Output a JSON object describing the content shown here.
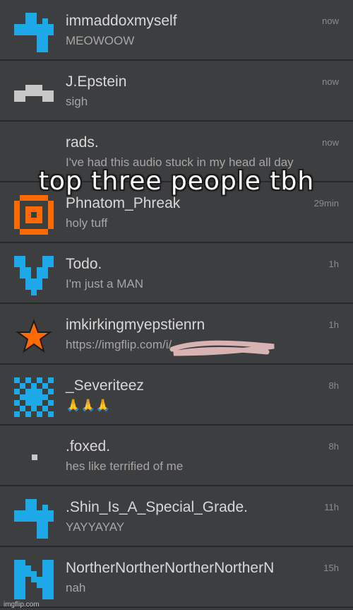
{
  "colors": {
    "blue": "#1da8e8",
    "orange": "#ff6a00",
    "gray": "#c8c8c8",
    "scribble": "#d7b3b3"
  },
  "rows": [
    {
      "name": "immaddoxmyself",
      "message": "MEOWOOW",
      "time": "now",
      "avatar": "blue-hook-icon"
    },
    {
      "name": "J.Epstein",
      "message": "sigh",
      "time": "now",
      "avatar": "gray-bar-icon"
    },
    {
      "name": "rads.",
      "message": "I've had this audio stuck in my head all day",
      "time": "now",
      "avatar": "none"
    },
    {
      "name": "Phnatom_Phreak",
      "message": "holy tuff",
      "time": "29min",
      "avatar": "orange-ring-icon"
    },
    {
      "name": "Todo.",
      "message": "I'm just a MAN",
      "time": "1h",
      "avatar": "blue-v-icon"
    },
    {
      "name": "imkirkingmyepstienrn",
      "message": "https://imgflip.com/i/",
      "time": "1h",
      "avatar": "orange-star-icon"
    },
    {
      "name": "_Severiteez",
      "message": "🙏🙏🙏",
      "time": "8h",
      "avatar": "blue-checker-icon"
    },
    {
      "name": ".foxed.",
      "message": "hes like terrified of me",
      "time": "8h",
      "avatar": "small-square-icon"
    },
    {
      "name": ".Shin_Is_A_Special_Grade.",
      "message": "YAYYAYAY",
      "time": "11h",
      "avatar": "blue-hook-icon"
    },
    {
      "name": "NortherNortherNortherNortherN",
      "message": "nah",
      "time": "15h",
      "avatar": "blue-n-icon"
    }
  ],
  "overlay_text": "top three people tbh",
  "watermark": "imgflip.com"
}
